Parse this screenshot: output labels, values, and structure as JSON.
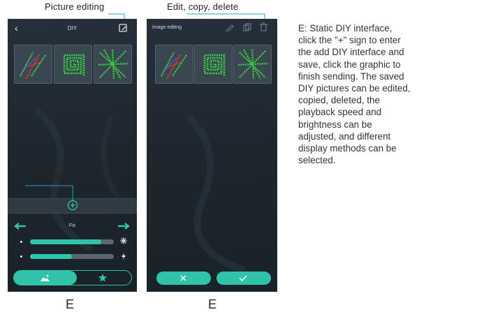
{
  "annotations": {
    "picture_editing": "Picture editing",
    "edit_copy_delete": "Edit, copy, delete",
    "add_diy": "Add DIY"
  },
  "screen_left": {
    "title": "DIY",
    "mode_label": "Fix",
    "speed_level": 0.85,
    "brightness_level": 0.5,
    "tabs": [
      "image-icon",
      "star-icon"
    ],
    "accent": "#31c3a9"
  },
  "screen_right": {
    "title": "Image editing",
    "toolbar_icons": [
      "pencil-icon",
      "copy-icon",
      "trash-icon"
    ],
    "buttons": [
      "close-icon",
      "check-icon"
    ]
  },
  "description_lines": [
    "E: Static DIY interface,",
    "click the \"+\" sign to enter",
    "the add DIY interface and",
    "save, click the graphic to",
    "finish sending. The saved",
    "DIY pictures can be edited,",
    "copied, deleted, the",
    "playback speed and",
    "brightness can be",
    "adjusted, and different",
    "display methods can be",
    "selected."
  ],
  "captions": [
    "E",
    "E"
  ]
}
